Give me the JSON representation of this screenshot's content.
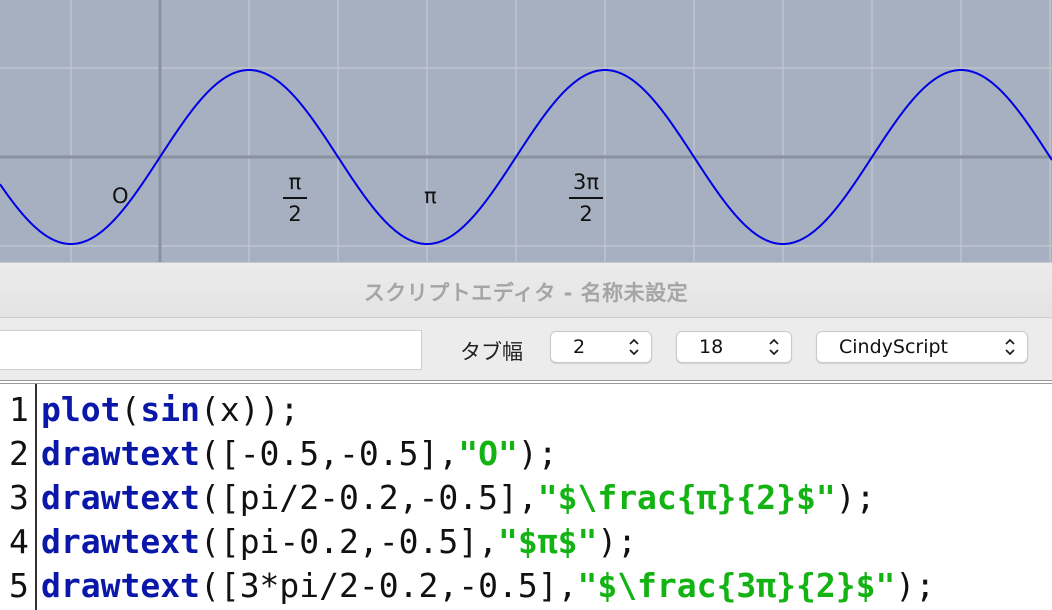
{
  "canvas": {
    "background": "#a7b0c0",
    "curve_color": "#0000e6",
    "function": "sin(x)",
    "labels": {
      "origin": "O",
      "pi_half_num": "π",
      "pi_half_den": "2",
      "pi": "π",
      "three_pi_half_num": "3π",
      "three_pi_half_den": "2"
    }
  },
  "window": {
    "title": "スクリプトエディタ - 名称未設定"
  },
  "toolbar": {
    "search_value": "",
    "tab_width_label": "タブ幅",
    "tab_width_value": "2",
    "font_size_value": "18",
    "language_value": "CindyScript"
  },
  "editor": {
    "line_numbers": [
      "1",
      "2",
      "3",
      "4",
      "5"
    ],
    "lines": [
      [
        {
          "t": "plot",
          "k": "kw"
        },
        {
          "t": "(",
          "k": "plain"
        },
        {
          "t": "sin",
          "k": "kw"
        },
        {
          "t": "(x));",
          "k": "plain"
        }
      ],
      [
        {
          "t": "drawtext",
          "k": "kw"
        },
        {
          "t": "([-0.5,-0.5],",
          "k": "plain"
        },
        {
          "t": "\"O\"",
          "k": "str"
        },
        {
          "t": ");",
          "k": "plain"
        }
      ],
      [
        {
          "t": "drawtext",
          "k": "kw"
        },
        {
          "t": "([pi/2-0.2,-0.5],",
          "k": "plain"
        },
        {
          "t": "\"$\\frac{π}{2}$\"",
          "k": "str"
        },
        {
          "t": ");",
          "k": "plain"
        }
      ],
      [
        {
          "t": "drawtext",
          "k": "kw"
        },
        {
          "t": "([pi-0.2,-0.5],",
          "k": "plain"
        },
        {
          "t": "\"$π$\"",
          "k": "str"
        },
        {
          "t": ");",
          "k": "plain"
        }
      ],
      [
        {
          "t": "drawtext",
          "k": "kw"
        },
        {
          "t": "([3*pi/2-0.2,-0.5],",
          "k": "plain"
        },
        {
          "t": "\"$\\frac{3π}{2}$\"",
          "k": "str"
        },
        {
          "t": ");",
          "k": "plain"
        }
      ]
    ],
    "keyword_color": "#0a17a8",
    "string_color": "#13b313"
  }
}
